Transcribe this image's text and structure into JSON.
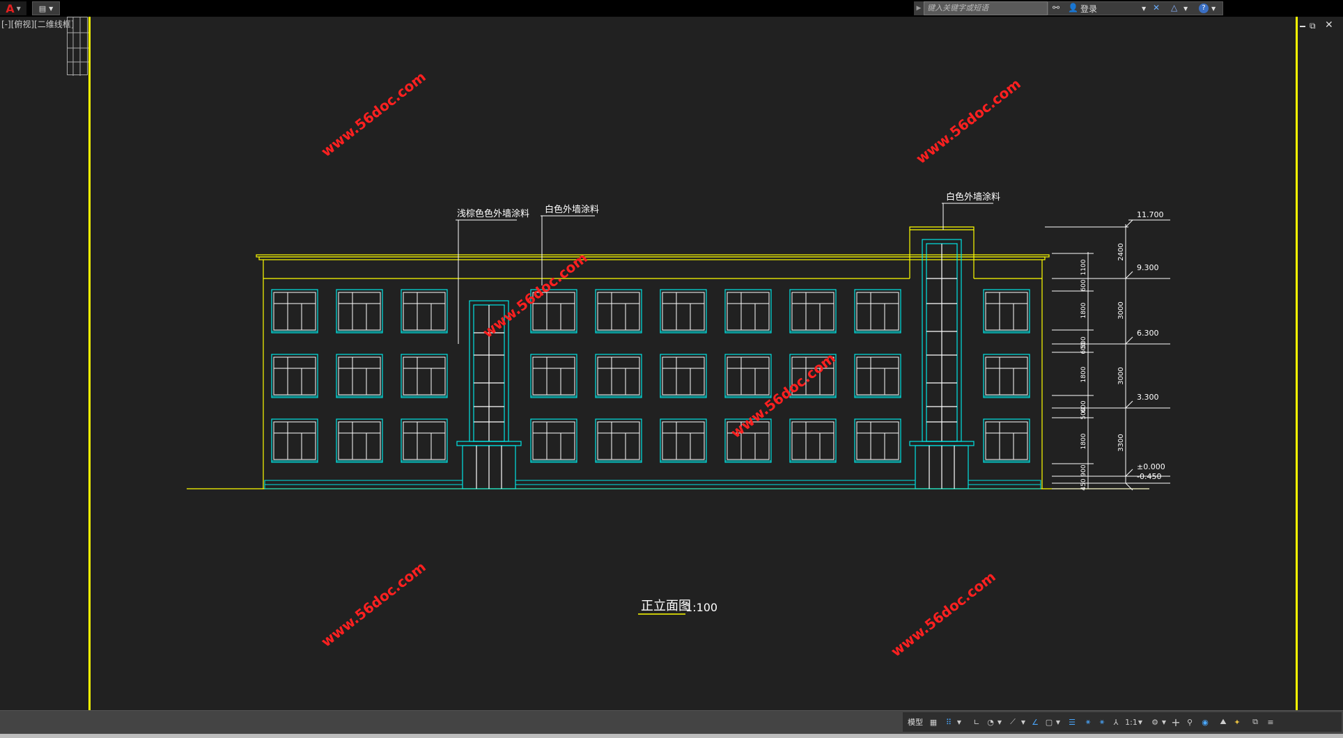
{
  "app": {
    "search_placeholder": "键入关键字或短语",
    "login_label": "登录",
    "viewport_label": "[-][俯视][二维线框]"
  },
  "drawing": {
    "title": "正立面图",
    "scale": "1:100",
    "notes": {
      "left_material": "浅棕色色外墙涂料",
      "mid_material": "白色外墙涂料",
      "right_material": "白色外墙涂料"
    },
    "elevations": [
      "11.700",
      "9.300",
      "6.300",
      "3.300",
      "±0.000",
      "-0.450"
    ],
    "dims_outer": [
      "2400",
      "3000",
      "3000",
      "3300"
    ],
    "dims_inner": [
      "1100",
      "600",
      "1800",
      "500",
      "600",
      "1800",
      "600",
      "500",
      "1800",
      "900",
      "450"
    ],
    "watermark": "www.56doc.com"
  },
  "statusbar": {
    "model_label": "模型",
    "scale_label": "1:1"
  },
  "colors": {
    "yellow": "#ffff00",
    "cyan": "#00e5e5",
    "white": "#ffffff",
    "watermark": "#ff2020",
    "background": "#212121"
  }
}
